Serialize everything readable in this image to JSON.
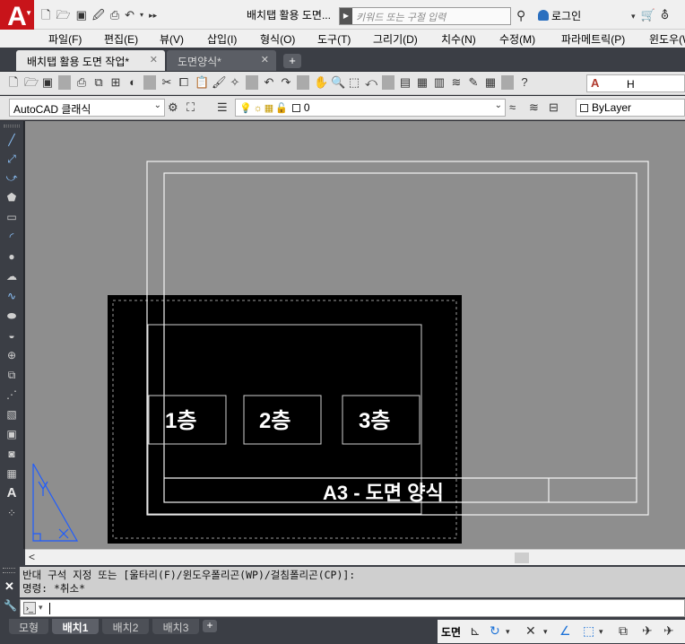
{
  "titlebar": {
    "app_letter": "A",
    "document_title": "배치탭 활용 도면...",
    "search_placeholder": "키워드 또는 구절 입력",
    "login_label": "로그인"
  },
  "menu": [
    "파일(F)",
    "편집(E)",
    "뷰(V)",
    "삽입(I)",
    "형식(O)",
    "도구(T)",
    "그리기(D)",
    "치수(N)",
    "수정(M)",
    "파라메트릭(P)",
    "윈도우(W)"
  ],
  "doc_tabs": [
    {
      "label": "배치탭 활용 도면 작업*",
      "active": true
    },
    {
      "label": "도면양식*",
      "active": false
    }
  ],
  "toolbar": {
    "text_style_value": "H",
    "workspace": "AutoCAD 클래식",
    "current_layer": "0",
    "color": "ByLayer"
  },
  "drawing": {
    "rooms": [
      "1층",
      "2층",
      "3층"
    ],
    "title_block_text": "A3 - 도면 양식"
  },
  "command": {
    "history_line_1": "반대 구석 지정 또는 [울타리(F)/윈도우폴리곤(WP)/걸침폴리곤(CP)]:",
    "history_line_2": "명령: *취소*"
  },
  "layout_tabs": [
    {
      "label": "모형",
      "active": false
    },
    {
      "label": "배치1",
      "active": true
    },
    {
      "label": "배치2",
      "active": false
    },
    {
      "label": "배치3",
      "active": false
    }
  ],
  "status": {
    "space": "도면"
  },
  "colors": {
    "accent_red": "#c8141a",
    "ui_dark": "#3b3e45",
    "canvas_gray": "#8e8e8e",
    "ucs_blue": "#1e5cff"
  }
}
